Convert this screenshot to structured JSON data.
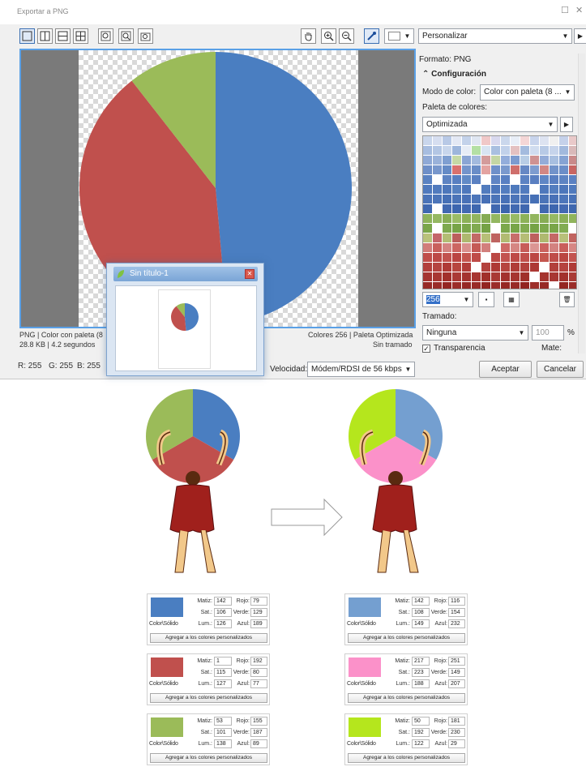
{
  "window": {
    "title": "Exportar a PNG"
  },
  "toolbar": {
    "view_buttons": [
      "single-view",
      "split-vertical",
      "split-horizontal",
      "quad-view"
    ],
    "zoom_buttons": [
      "zoom-fit",
      "zoom-in-page",
      "zoom-out-page"
    ],
    "preset": "Personalizar"
  },
  "right_panel": {
    "format": "Formato: PNG",
    "section": "Configuración",
    "color_mode_label": "Modo de color:",
    "color_mode_value": "Color con paleta (8 ...",
    "palette_label": "Paleta de colores:",
    "palette_value": "Optimizada",
    "colors_count": "256",
    "dither_label": "Tramado:",
    "dither_value": "Ninguna",
    "dither_amount": "100",
    "percent": "%",
    "transparency_label": "Transparencia",
    "matte_label": "Mate:"
  },
  "status": {
    "left1": "PNG  |  Color con paleta (8",
    "left2": "28.8 KB  |  4.2 segundos",
    "right1": "Colores 256  |  Paleta Optimizada",
    "right2": "Sin tramado",
    "rgb_r": "R: 255",
    "rgb_g": "G: 255",
    "rgb_b": "B: 255"
  },
  "thumbnail": {
    "title": "Sin título-1"
  },
  "footer": {
    "speed_label": "Velocidad:",
    "speed_value": "Módem/RDSI de 56 kbps",
    "ok": "Aceptar",
    "cancel": "Cancelar"
  },
  "colors": {
    "blue": "#4a7ec1",
    "red": "#c0504d",
    "green": "#9bbb59",
    "blue2": "#749fd0",
    "pink": "#fb91c9",
    "lime": "#b5e61d",
    "dress": "#a0201c",
    "skin": "#f2c88a",
    "hair": "#5a2a10"
  },
  "swatch_text": {
    "solid": "Color\\Sólido",
    "add_left": "Agregar a los colores personalizados",
    "add_right": "Agregar a los colores personalizados"
  },
  "cards_left": [
    {
      "color": "#4a7ec1",
      "matiz": "142",
      "sat": "106",
      "lum": "126",
      "rojo": "79",
      "verde": "129",
      "azul": "189"
    },
    {
      "color": "#c0504d",
      "matiz": "1",
      "sat": "115",
      "lum": "127",
      "rojo": "192",
      "verde": "80",
      "azul": "77"
    },
    {
      "color": "#9bbb59",
      "matiz": "53",
      "sat": "101",
      "lum": "138",
      "rojo": "155",
      "verde": "187",
      "azul": "89"
    }
  ],
  "cards_right": [
    {
      "color": "#749fd0",
      "matiz": "142",
      "sat": "108",
      "lum": "149",
      "rojo": "116",
      "verde": "154",
      "azul": "232"
    },
    {
      "color": "#fb91c9",
      "matiz": "217",
      "sat": "223",
      "lum": "188",
      "rojo": "251",
      "verde": "149",
      "azul": "207"
    },
    {
      "color": "#b5e61d",
      "matiz": "50",
      "sat": "192",
      "lum": "122",
      "rojo": "181",
      "verde": "230",
      "azul": "29"
    }
  ],
  "labels": {
    "matiz": "Matiz:",
    "sat": "Sat.:",
    "lum": "Lum.:",
    "rojo": "Rojo:",
    "verde": "Verde:",
    "azul": "Azul:"
  }
}
